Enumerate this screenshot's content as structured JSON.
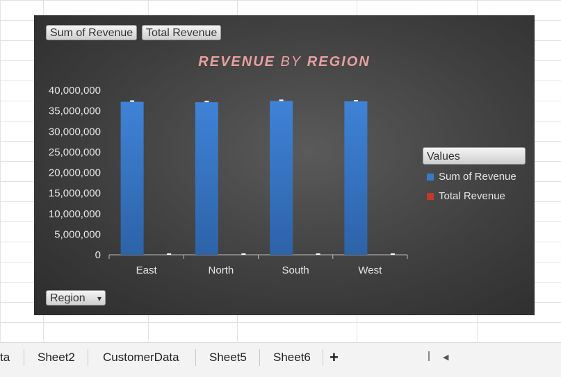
{
  "chart_data": {
    "type": "bar",
    "title": {
      "part1": "REVENUE",
      "part2": "BY",
      "part3": "REGION"
    },
    "categories": [
      "East",
      "North",
      "South",
      "West"
    ],
    "series": [
      {
        "name": "Sum of Revenue",
        "color": "#3a78c9",
        "values": [
          37200000,
          37100000,
          37400000,
          37300000
        ]
      },
      {
        "name": "Total Revenue",
        "color": "#c0392b",
        "values": [
          0,
          0,
          0,
          0
        ]
      }
    ],
    "ylim": [
      0,
      40000000
    ],
    "yticks": [
      "0",
      "5,000,000",
      "10,000,000",
      "15,000,000",
      "20,000,000",
      "25,000,000",
      "30,000,000",
      "35,000,000",
      "40,000,000"
    ],
    "legend_position": "right",
    "legend_title": "Values"
  },
  "field_buttons": {
    "values_1": "Sum of Revenue",
    "values_2": "Total Revenue",
    "axis_field": "Region"
  },
  "sheet_tabs": [
    "ta",
    "Sheet2",
    "CustomerData",
    "Sheet5",
    "Sheet6"
  ],
  "icons": {
    "add_sheet": "+",
    "scroll_left": "◀",
    "dropdown": "▾"
  }
}
